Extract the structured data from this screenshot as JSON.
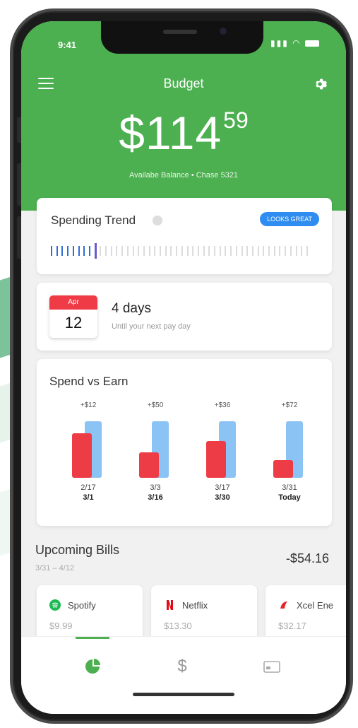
{
  "status": {
    "time": "9:41"
  },
  "header": {
    "title": "Budget"
  },
  "balance": {
    "dollars": "$114",
    "cents": "59",
    "subtitle": "Availabe Balance • Chase 5321"
  },
  "spending_trend": {
    "title": "Spending Trend",
    "badge": "LOOKS GREAT",
    "progress_fraction": 0.17
  },
  "payday": {
    "month": "Apr",
    "day": "12",
    "title": "4 days",
    "subtitle": "Until your next pay day"
  },
  "spend_vs_earn": {
    "title": "Spend vs Earn",
    "groups": [
      {
        "earn_label": "+$12",
        "date1": "2/17",
        "date2": "3/1"
      },
      {
        "earn_label": "+$50",
        "date1": "3/3",
        "date2": "3/16"
      },
      {
        "earn_label": "+$36",
        "date1": "3/17",
        "date2": "3/30"
      },
      {
        "earn_label": "+$72",
        "date1": "3/31",
        "date2": "Today"
      }
    ]
  },
  "chart_data": {
    "type": "bar",
    "title": "Spend vs Earn",
    "categories": [
      "2/17–3/1",
      "3/3–3/16",
      "3/17–3/30",
      "3/31–Today"
    ],
    "series": [
      {
        "name": "Earn",
        "values": [
          100,
          100,
          100,
          100
        ]
      },
      {
        "name": "Spend",
        "values": [
          84,
          50,
          70,
          36
        ]
      }
    ],
    "ylim": [
      0,
      100
    ]
  },
  "bills": {
    "title": "Upcoming Bills",
    "range": "3/31 – 4/12",
    "total": "-$54.16",
    "items": [
      {
        "name": "Spotify",
        "amount": "$9.99",
        "color": "#1db954"
      },
      {
        "name": "Netflix",
        "amount": "$13.30",
        "color": "#e50914"
      },
      {
        "name": "Xcel Ene",
        "amount": "$32.17",
        "color": "#e3262b"
      }
    ]
  },
  "colors": {
    "brand_green": "#4caf50",
    "earn_blue": "#8cc3f5",
    "spend_red": "#ee3c46",
    "badge_blue": "#2f8cf0"
  },
  "tabs": [
    {
      "icon": "pie-chart-icon",
      "active": true
    },
    {
      "icon": "dollar-icon",
      "active": false
    },
    {
      "icon": "card-icon",
      "active": false
    }
  ]
}
